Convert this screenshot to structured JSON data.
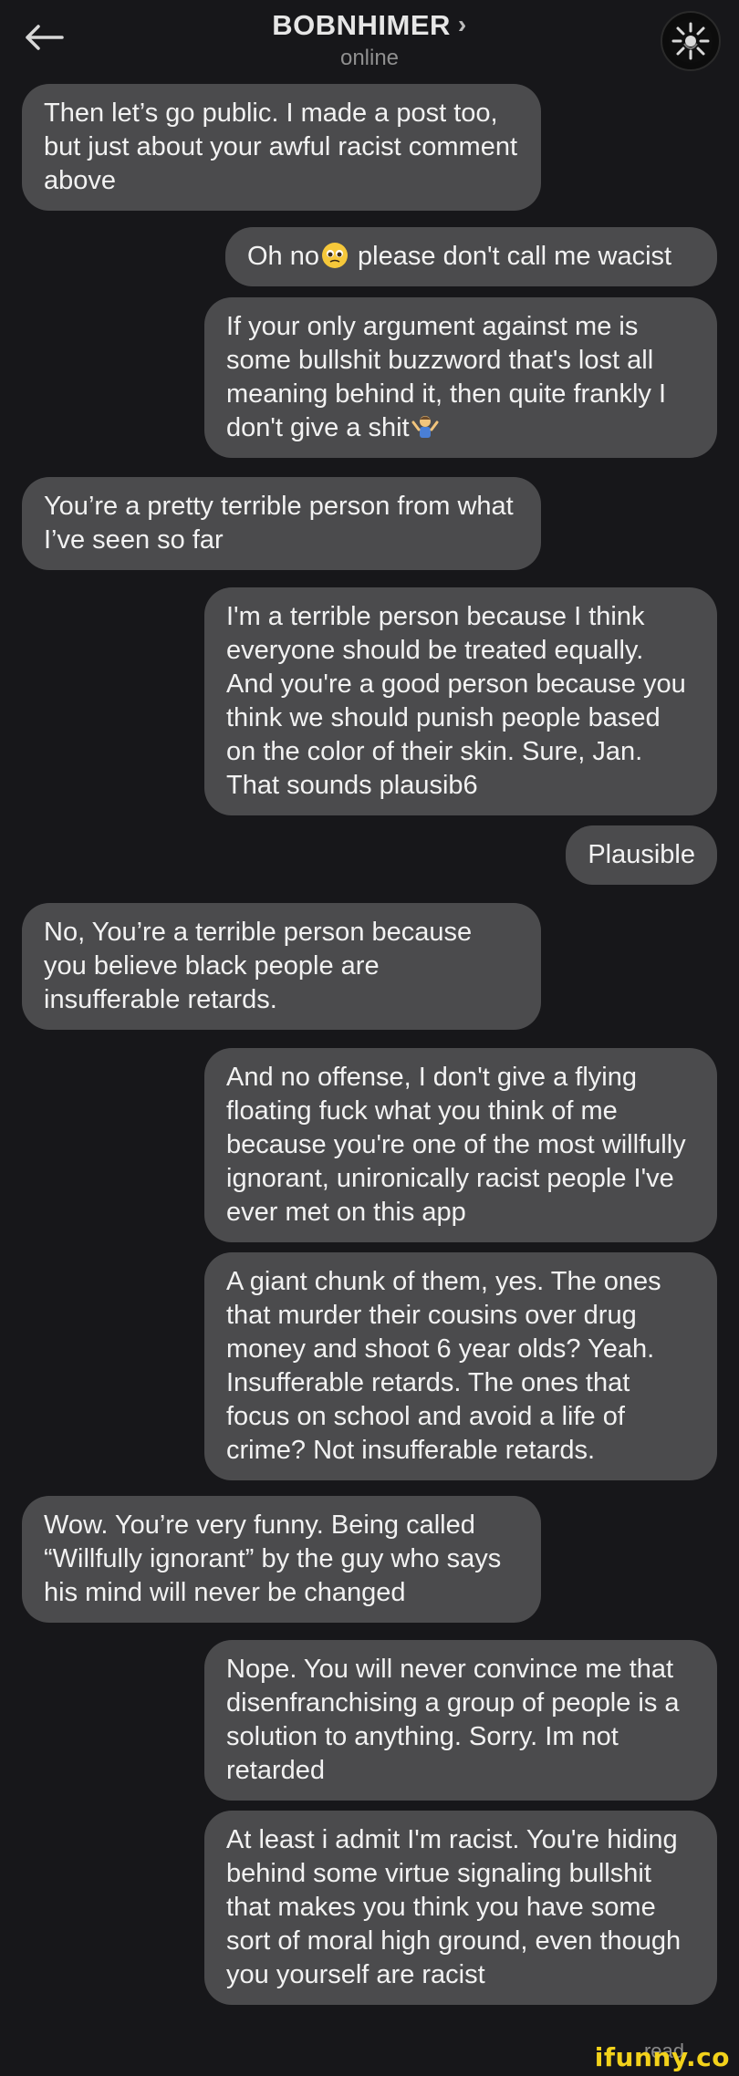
{
  "header": {
    "title": "BOBNHIMER",
    "chevron": "›",
    "status": "online",
    "back_icon": "arrow-left-icon",
    "avatar_icon": "avatar"
  },
  "messages": [
    {
      "dir": "in",
      "text": "Then let’s go public. I made a post too, but just about your awful racist comment above"
    },
    {
      "dir": "out",
      "text_before": "Oh no",
      "text_after": " please don't call me wacist",
      "emoji": "pleading-face-emoji"
    },
    {
      "dir": "out",
      "text": "If your only argument against me is some bullshit buzzword that's lost all meaning behind it, then quite frankly I don't give a shit",
      "emoji": "shrug-emoji"
    },
    {
      "dir": "in",
      "text": "You’re a pretty terrible person from what I’ve seen so far"
    },
    {
      "dir": "out",
      "text": "I'm a terrible person because I think everyone should be treated equally. And you're a good person because you think we should punish people based on the color of their skin. Sure, Jan. That sounds plausib6"
    },
    {
      "dir": "out",
      "text": "Plausible"
    },
    {
      "dir": "in",
      "text": "No, You’re a terrible person because you believe black people are insufferable retards."
    },
    {
      "dir": "out",
      "text": "And no offense, I don't give a flying floating fuck what you think of me because you're one of the most willfully ignorant, unironically racist people I've ever met on this app"
    },
    {
      "dir": "out",
      "text": "A giant chunk of them, yes. The ones that murder their cousins over drug money and shoot 6 year olds? Yeah. Insufferable retards. The ones that focus on school and avoid a life of crime? Not insufferable retards."
    },
    {
      "dir": "in",
      "text": "Wow. You’re very funny. Being called “Willfully ignorant” by the guy who says his mind will never be changed"
    },
    {
      "dir": "out",
      "text": "Nope. You will never convince me that disenfranchising a group of people is a solution to anything. Sorry. Im not retarded"
    },
    {
      "dir": "out",
      "text": "At least i admit I'm racist. You're hiding behind some virtue signaling bullshit that makes you think you have some sort of moral high ground, even though you yourself are racist"
    }
  ],
  "read_receipt": "read",
  "watermark": "ifunny.co",
  "colors": {
    "background": "#17171a",
    "bubble": "#4b4b4d",
    "text": "#f2f2f2",
    "watermark": "#f2d21b"
  }
}
